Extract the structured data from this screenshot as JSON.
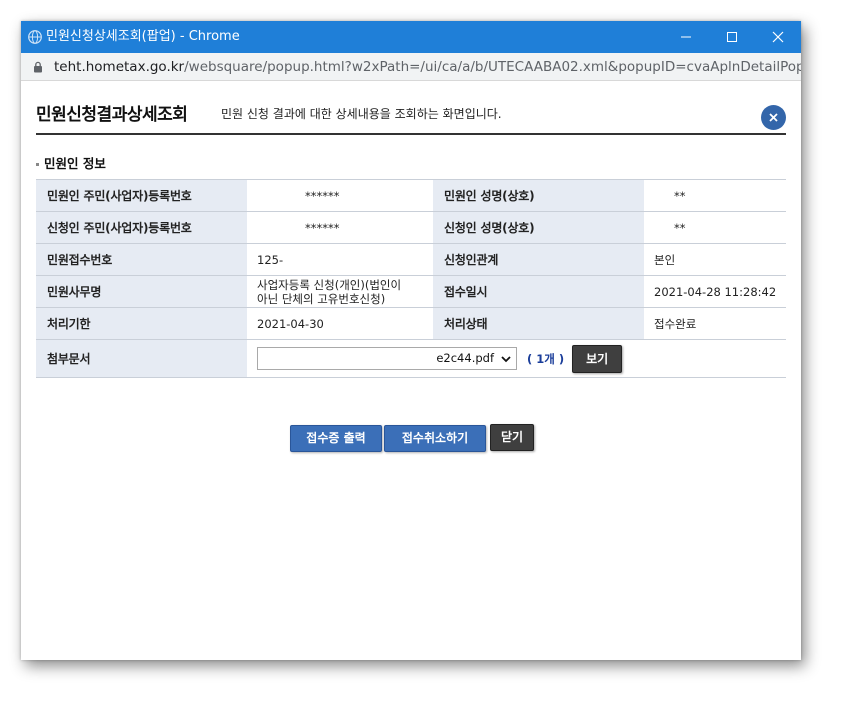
{
  "window": {
    "title": "민원신청상세조회(팝업) - Chrome",
    "url_host": "teht.hometax.go.kr",
    "url_path": "/websquare/popup.html?w2xPath=/ui/ca/a/b/UTECAABA02.xml&popupID=cvaAplnDetailPopU..."
  },
  "header": {
    "title": "민원신청결과상세조회",
    "description": "민원 신청 결과에 대한 상세내용을 조회하는 화면입니다."
  },
  "section": {
    "title": "민원인 정보"
  },
  "info": {
    "civil_id_label": "민원인 주민(사업자)등록번호",
    "civil_id_value": "******",
    "civil_name_label": "민원인 성명(상호)",
    "civil_name_value": "**",
    "applicant_id_label": "신청인 주민(사업자)등록번호",
    "applicant_id_value": "******",
    "applicant_name_label": "신청인 성명(상호)",
    "applicant_name_value": "**",
    "receipt_no_label": "민원접수번호",
    "receipt_no_value": "125-",
    "relation_label": "신청인관계",
    "relation_value": "본인",
    "affair_label": "민원사무명",
    "affair_value_line1": "사업자등록 신청(개인)(법인이",
    "affair_value_line2": "아닌 단체의 고유번호신청)",
    "receipt_date_label": "접수일시",
    "receipt_date_value": "2021-04-28 11:28:42",
    "deadline_label": "처리기한",
    "deadline_value": "2021-04-30",
    "status_label": "처리상태",
    "status_value": "접수완료",
    "attach_label": "첨부문서",
    "attach_file": "e2c44.pdf",
    "attach_count": "( 1개 )",
    "view_button": "보기"
  },
  "actions": {
    "print_receipt": "접수증 출력",
    "cancel_receipt": "접수취소하기",
    "close": "닫기"
  },
  "colors": {
    "titlebar": "#1f7fd8",
    "header_cell": "#e6ebf3",
    "primary_button": "#3b6fb8",
    "dark_button": "#3f3f3f",
    "close_circle": "#3366aa"
  },
  "icons": {
    "app": "chrome-globe-icon",
    "lock": "lock-icon",
    "minimize": "minimize-icon",
    "maximize": "maximize-icon",
    "close": "close-icon"
  }
}
